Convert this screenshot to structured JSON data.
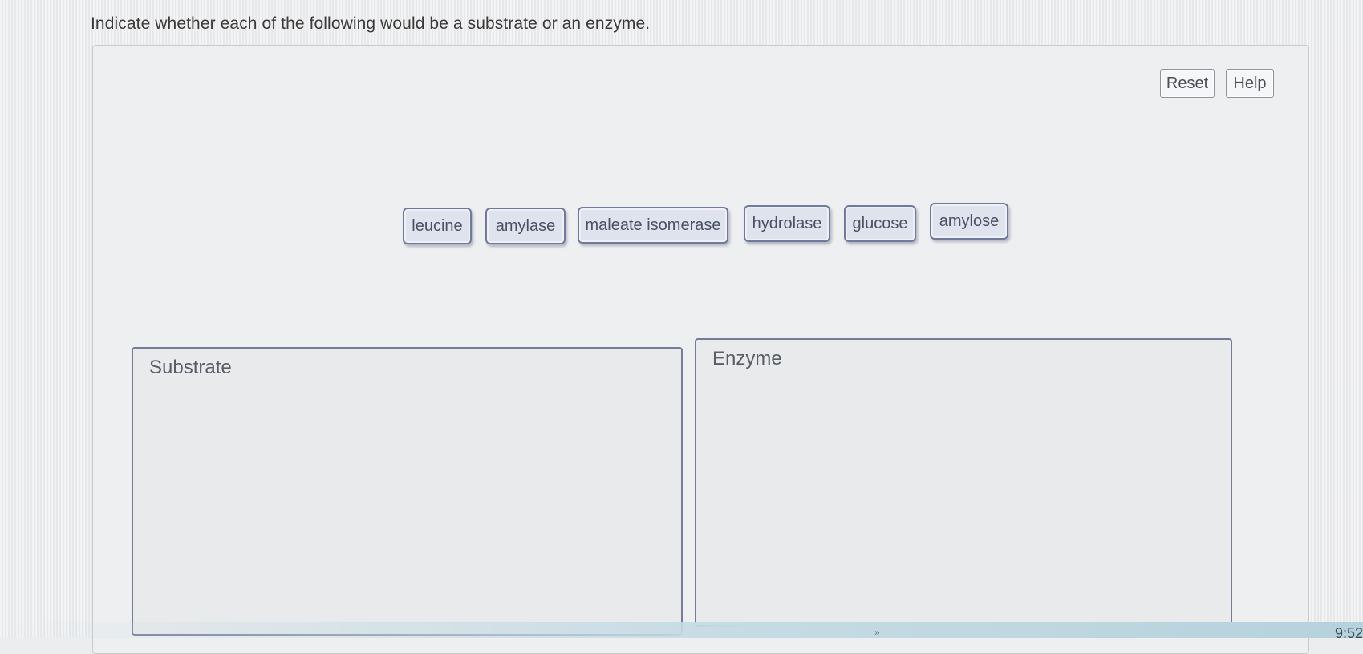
{
  "question": {
    "prompt": "Indicate whether each of the following would be a substrate or an enzyme."
  },
  "toolbar": {
    "reset_label": "Reset",
    "help_label": "Help"
  },
  "tiles": [
    {
      "label": "leucine"
    },
    {
      "label": "amylase"
    },
    {
      "label": "maleate isomerase"
    },
    {
      "label": "hydrolase"
    },
    {
      "label": "glucose"
    },
    {
      "label": "amylose"
    }
  ],
  "bins": {
    "substrate_label": "Substrate",
    "enzyme_label": "Enzyme"
  },
  "system": {
    "clock": "9:52",
    "chevron_icon": "double-chevron-right-icon"
  },
  "colors": {
    "tile_border": "#707a9d",
    "tile_fill": "#dfe3ee",
    "bin_border": "#757b99"
  }
}
